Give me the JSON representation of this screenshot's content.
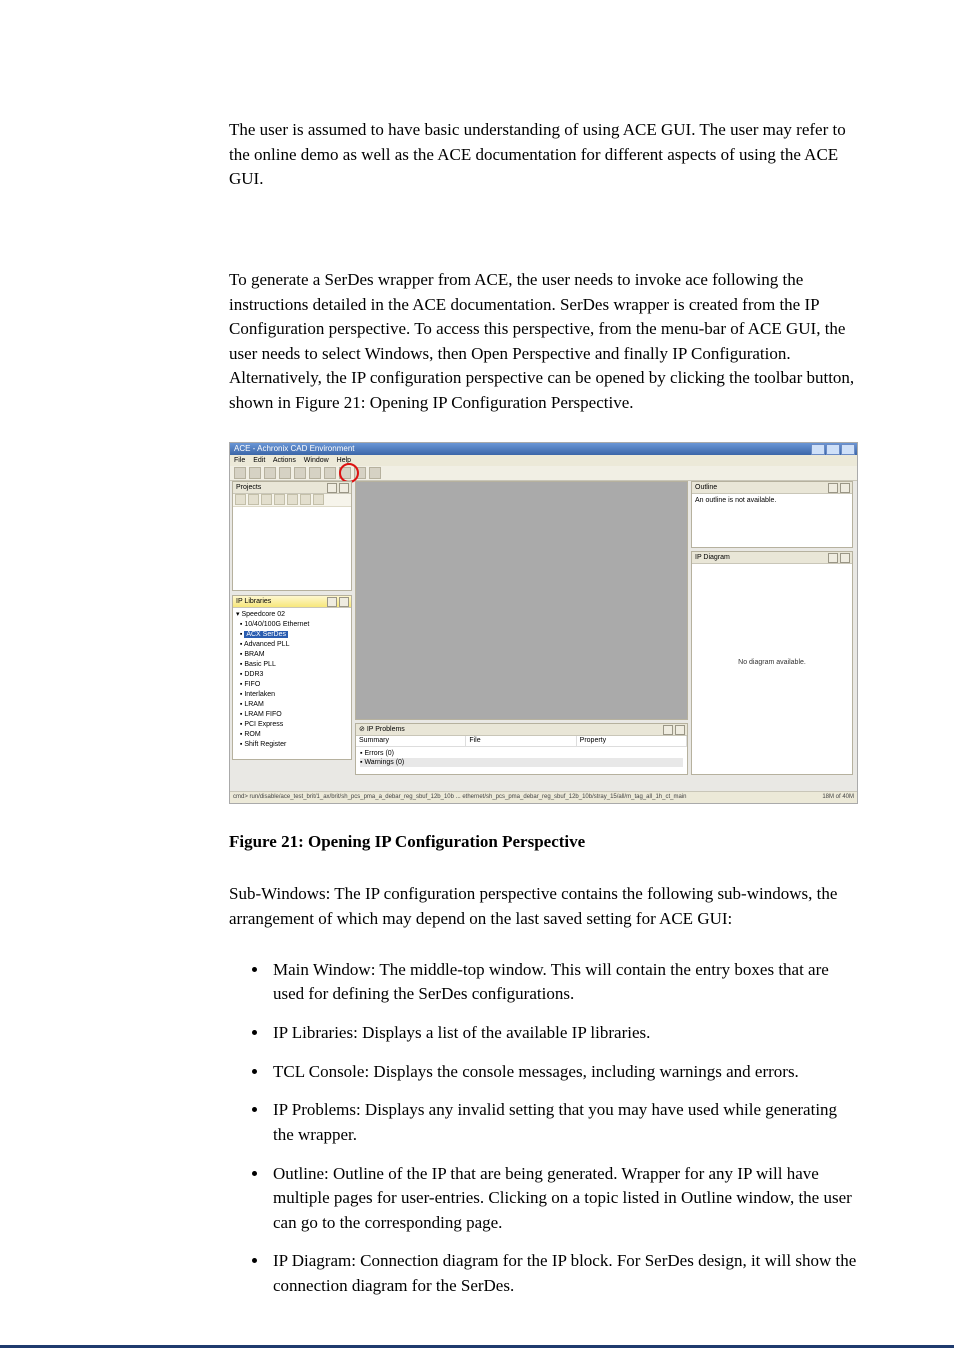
{
  "paragraph1": "The user is assumed to have basic understanding of using ACE GUI. The user may refer to the online demo as well as the ACE documentation for different aspects of using the ACE GUI.",
  "paragraph2": "To generate a SerDes wrapper from ACE, the user needs to invoke ace following the instructions detailed in the ACE documentation. SerDes wrapper is created from the IP Configuration perspective. To access this perspective, from the menu-bar of ACE GUI, the user needs to select Windows, then Open Perspective and finally IP Configuration. Alternatively, the IP configuration perspective can be opened by clicking the toolbar button, shown in Figure 21: Opening IP Configuration Perspective.",
  "figure_caption": "Figure 21: Opening IP Configuration Perspective",
  "sub_intro": "Sub-Windows: The IP configuration perspective contains the following sub-windows, the arrangement of which may depend on the last saved setting for ACE GUI:",
  "bullets": [
    "Main Window: The middle-top window. This will contain the entry boxes that are used for defining the SerDes configurations.",
    "IP Libraries: Displays a list of the available IP libraries.",
    "TCL Console: Displays the console messages, including warnings and errors.",
    "IP Problems: Displays any invalid setting that you may have used while generating the wrapper.",
    "Outline: Outline of the IP that are being generated. Wrapper for any IP will have multiple pages for user-entries. Clicking on a topic listed in Outline window, the user can go to the corresponding page.",
    "IP Diagram: Connection diagram for the IP block. For SerDes design, it will show the connection diagram for the SerDes."
  ],
  "screenshot": {
    "title": "ACE - Achronix CAD Environment",
    "menus": [
      "File",
      "Edit",
      "Actions",
      "Window",
      "Help"
    ],
    "panes": {
      "projects": "Projects",
      "iplib": "IP Libraries",
      "outline": "Outline",
      "outline_msg": "An outline is not available.",
      "ipdiagram": "IP Diagram",
      "ipdiagram_msg": "No diagram available.",
      "problems": "IP Problems"
    },
    "iptree_root": "Speedcore 02",
    "iptree_items": [
      "10/40/100G Ethernet",
      "ACX SerDes",
      "Advanced PLL",
      "BRAM",
      "Basic PLL",
      "DDR3",
      "FIFO",
      "Interlaken",
      "LRAM",
      "LRAM FIFO",
      "PCI Express",
      "ROM",
      "Shift Register"
    ],
    "iptree_selected_index": 1,
    "prob_cols": [
      "Summary",
      "File",
      "Property"
    ],
    "prob_errors": "Errors (0)",
    "prob_warnings": "Warnings (0)",
    "status_left": "cmd> run/disable/ace_test_brit/1_ax/brit/sh_pcs_pma_a_debar_reg_sbuf_12b_10b ... ethernet/sh_pcs_pma_debar_reg_sbuf_12b_10b/stray_15/all/m_tag_all_1h_ct_main",
    "status_right": "18M of 40M"
  }
}
